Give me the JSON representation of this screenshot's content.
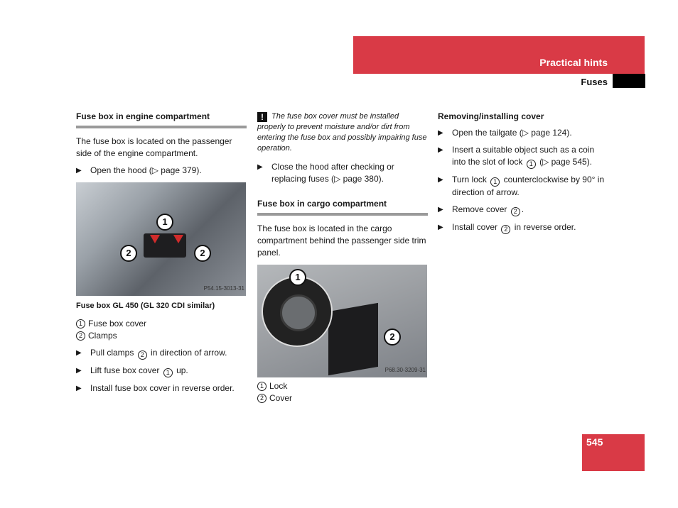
{
  "header": {
    "section": "Practical hints",
    "subsection": "Fuses",
    "page_number": "545"
  },
  "col1": {
    "heading": "Fuse box in engine compartment",
    "intro": "The fuse box is located on the passenger side of the engine compartment.",
    "step_open": "Open the hood (▷ page 379).",
    "photo_code": "P54.15-3013-31",
    "caption": "Fuse box GL 450 (GL 320 CDI similar)",
    "legend": [
      {
        "num": "1",
        "label": "Fuse box cover"
      },
      {
        "num": "2",
        "label": "Clamps"
      }
    ],
    "steps": [
      {
        "pre": "Pull clamps",
        "num": "2",
        "post": "in direction of arrow."
      },
      {
        "pre": "Lift fuse box cover",
        "num": "1",
        "post": "up."
      },
      {
        "pre": "Install fuse box cover in reverse order.",
        "num": null,
        "post": ""
      }
    ]
  },
  "col2": {
    "warning_icon": "!",
    "warning": "The fuse box cover must be installed properly to prevent moisture and/or dirt from entering the fuse box and possibly impairing fuse operation.",
    "step_close": "Close the hood after checking or replacing fuses (▷ page 380).",
    "heading": "Fuse box in cargo compartment",
    "intro": "The fuse box is located in the cargo compartment behind the passenger side trim panel.",
    "photo_code": "P68.30-3209-31",
    "legend": [
      {
        "num": "1",
        "label": "Lock"
      },
      {
        "num": "2",
        "label": "Cover"
      }
    ]
  },
  "col3": {
    "heading": "Removing/installing cover",
    "steps": [
      {
        "pre": "Open the tailgate (▷ page 124).",
        "num": null,
        "post": ""
      },
      {
        "pre": "Insert a suitable object such as a coin into the slot of lock",
        "num": "1",
        "post": "(▷ page 545)."
      },
      {
        "pre": "Turn lock",
        "num": "1",
        "post": "counterclockwise by 90° in direction of arrow."
      },
      {
        "pre": "Remove cover",
        "num": "2",
        "post": "."
      },
      {
        "pre": "Install cover",
        "num": "2",
        "post": "in reverse order."
      }
    ]
  },
  "colors": {
    "accent": "#d93a46",
    "rule": "#9a9a9a"
  }
}
